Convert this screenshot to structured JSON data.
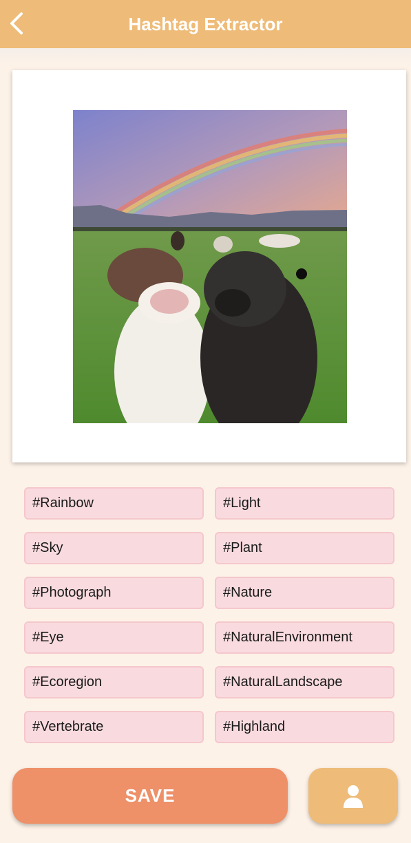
{
  "header": {
    "title": "Hashtag Extractor",
    "back_icon": "chevron-left-icon"
  },
  "photo": {
    "description_icon": "photo-image"
  },
  "tags": [
    "#Rainbow",
    "#Light",
    "#Sky",
    "#Plant",
    "#Photograph",
    "#Nature",
    "#Eye",
    "#NaturalEnvironment",
    "#Ecoregion",
    "#NaturalLandscape",
    "#Vertebrate",
    "#Highland"
  ],
  "actions": {
    "save_label": "SAVE",
    "profile_icon": "user-icon"
  },
  "colors": {
    "header": "#eebb78",
    "background": "#fdf2e8",
    "tag_fill": "#f9dbdf",
    "tag_border": "#f5c7cd",
    "save": "#ee9068"
  }
}
